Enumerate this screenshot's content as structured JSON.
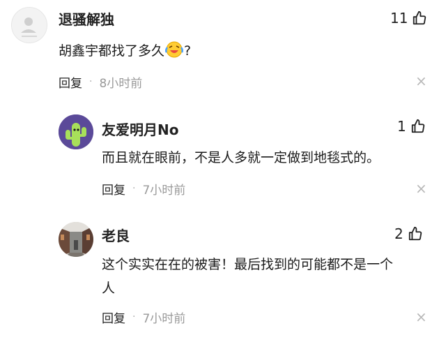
{
  "comments": [
    {
      "username": "退骚解独",
      "avatar_icon": "default-avatar-icon",
      "text_before": "胡鑫宇都找了多久",
      "emoji_icon": "laughing-crying-emoji",
      "text_after": "?",
      "likes": "11",
      "reply_label": "回复",
      "separator": "·",
      "time": "8小时前",
      "close_label": "×"
    },
    {
      "username": "友爱明月No",
      "avatar_icon": "cactus-avatar-icon",
      "text": "而且就在眼前，不是人多就一定做到地毯式的。",
      "likes": "1",
      "reply_label": "回复",
      "separator": "·",
      "time": "7小时前",
      "close_label": "×"
    },
    {
      "username": "老良",
      "avatar_icon": "street-photo-avatar-icon",
      "text_line1": "这个实实在在的被害！最后找到的可能都不是一个",
      "text_line2": "人",
      "likes": "2",
      "reply_label": "回复",
      "separator": "·",
      "time": "7小时前",
      "close_label": "×"
    }
  ],
  "colors": {
    "text": "#1a1a1a",
    "meta_gray": "#999999",
    "close_gray": "#b8b8b8",
    "cactus_bg": "#5b4a99",
    "cactus_green": "#a8e05a"
  }
}
